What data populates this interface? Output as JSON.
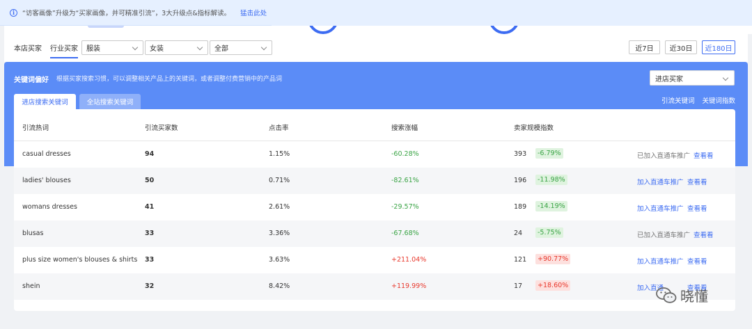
{
  "notice": {
    "text": "“访客画像”升级为“买家画像，并可精准引流”，3大升级点&指标解读。",
    "link": "猛击此处"
  },
  "top_tabs": [
    "本店买家",
    "行业买家"
  ],
  "filters": [
    "服装",
    "女装",
    "全部"
  ],
  "date_ranges": [
    "近7日",
    "近30日",
    "近180日"
  ],
  "panel": {
    "title": "关键词偏好",
    "description": "根据买家搜索习惯，可以调整相关产品上的关键词，或者调整付费营销中的产品词",
    "select_value": "进店买家",
    "tabs": [
      "进店搜索关键词",
      "全站搜索关键词"
    ],
    "links": [
      "引流关键词",
      "关键词指数"
    ]
  },
  "table": {
    "headers": [
      "引流热词",
      "引流买家数",
      "点击率",
      "搜索涨幅",
      "卖家规模指数"
    ],
    "rows": [
      {
        "keyword": "casual dresses",
        "buyers": "94",
        "ctr": "1.15%",
        "growth": "-60.28%",
        "trend": "down",
        "seller_index": "393",
        "seller_change": "-6.79%",
        "seller_trend": "down",
        "action": "已加入直通车推广",
        "action_added": true,
        "view": "查看看"
      },
      {
        "keyword": "ladies' blouses",
        "buyers": "50",
        "ctr": "0.71%",
        "growth": "-82.61%",
        "trend": "down",
        "seller_index": "196",
        "seller_change": "-11.98%",
        "seller_trend": "down",
        "action": "加入直通车推广",
        "action_added": false,
        "view": "查看看"
      },
      {
        "keyword": "womans dresses",
        "buyers": "41",
        "ctr": "2.61%",
        "growth": "-29.57%",
        "trend": "down",
        "seller_index": "189",
        "seller_change": "-14.19%",
        "seller_trend": "down",
        "action": "加入直通车推广",
        "action_added": false,
        "view": "查看看"
      },
      {
        "keyword": "blusas",
        "buyers": "33",
        "ctr": "3.36%",
        "growth": "-67.68%",
        "trend": "down",
        "seller_index": "24",
        "seller_change": "-5.75%",
        "seller_trend": "down",
        "action": "已加入直通车推广",
        "action_added": true,
        "view": "查看看"
      },
      {
        "keyword": "plus size women's blouses & shirts",
        "buyers": "33",
        "ctr": "3.63%",
        "growth": "+211.04%",
        "trend": "up",
        "seller_index": "121",
        "seller_change": "+90.77%",
        "seller_trend": "up",
        "action": "加入直通车推广",
        "action_added": false,
        "view": "查看看"
      },
      {
        "keyword": "shein",
        "buyers": "32",
        "ctr": "8.42%",
        "growth": "+119.99%",
        "trend": "up",
        "seller_index": "17",
        "seller_change": "+18.60%",
        "seller_trend": "up",
        "action": "加入直通",
        "action_added": false,
        "view": "查看看"
      }
    ]
  },
  "watermark": "晓懂",
  "colors": {
    "accent": "#3d6cf2",
    "panel": "#5b8cf7",
    "up": "#e8382c",
    "down": "#3aa445"
  }
}
